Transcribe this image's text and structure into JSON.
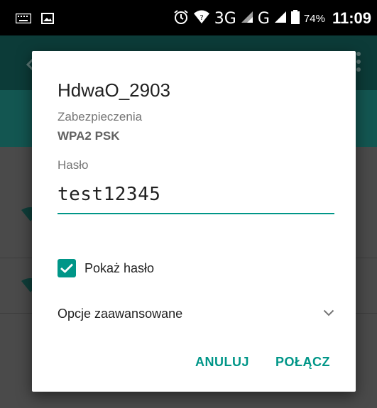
{
  "status_bar": {
    "network_3g": "3G",
    "network_g": "G",
    "battery": "74%",
    "time": "11:09",
    "icons": [
      "keyboard-icon",
      "image-icon",
      "alarm-icon",
      "wifi-question-icon",
      "signal-icon",
      "battery-icon"
    ]
  },
  "dialog": {
    "title": "HdwaO_2903",
    "security_label": "Zabezpieczenia",
    "security_value": "WPA2 PSK",
    "password_label": "Hasło",
    "password_value": "test12345",
    "show_password_label": "Pokaż hasło",
    "show_password_checked": true,
    "advanced_options_label": "Opcje zaawansowane",
    "cancel_label": "ANULUJ",
    "connect_label": "POŁĄCZ"
  },
  "colors": {
    "accent": "#009688",
    "status_bar": "#000000",
    "dialog_bg": "#ffffff"
  }
}
